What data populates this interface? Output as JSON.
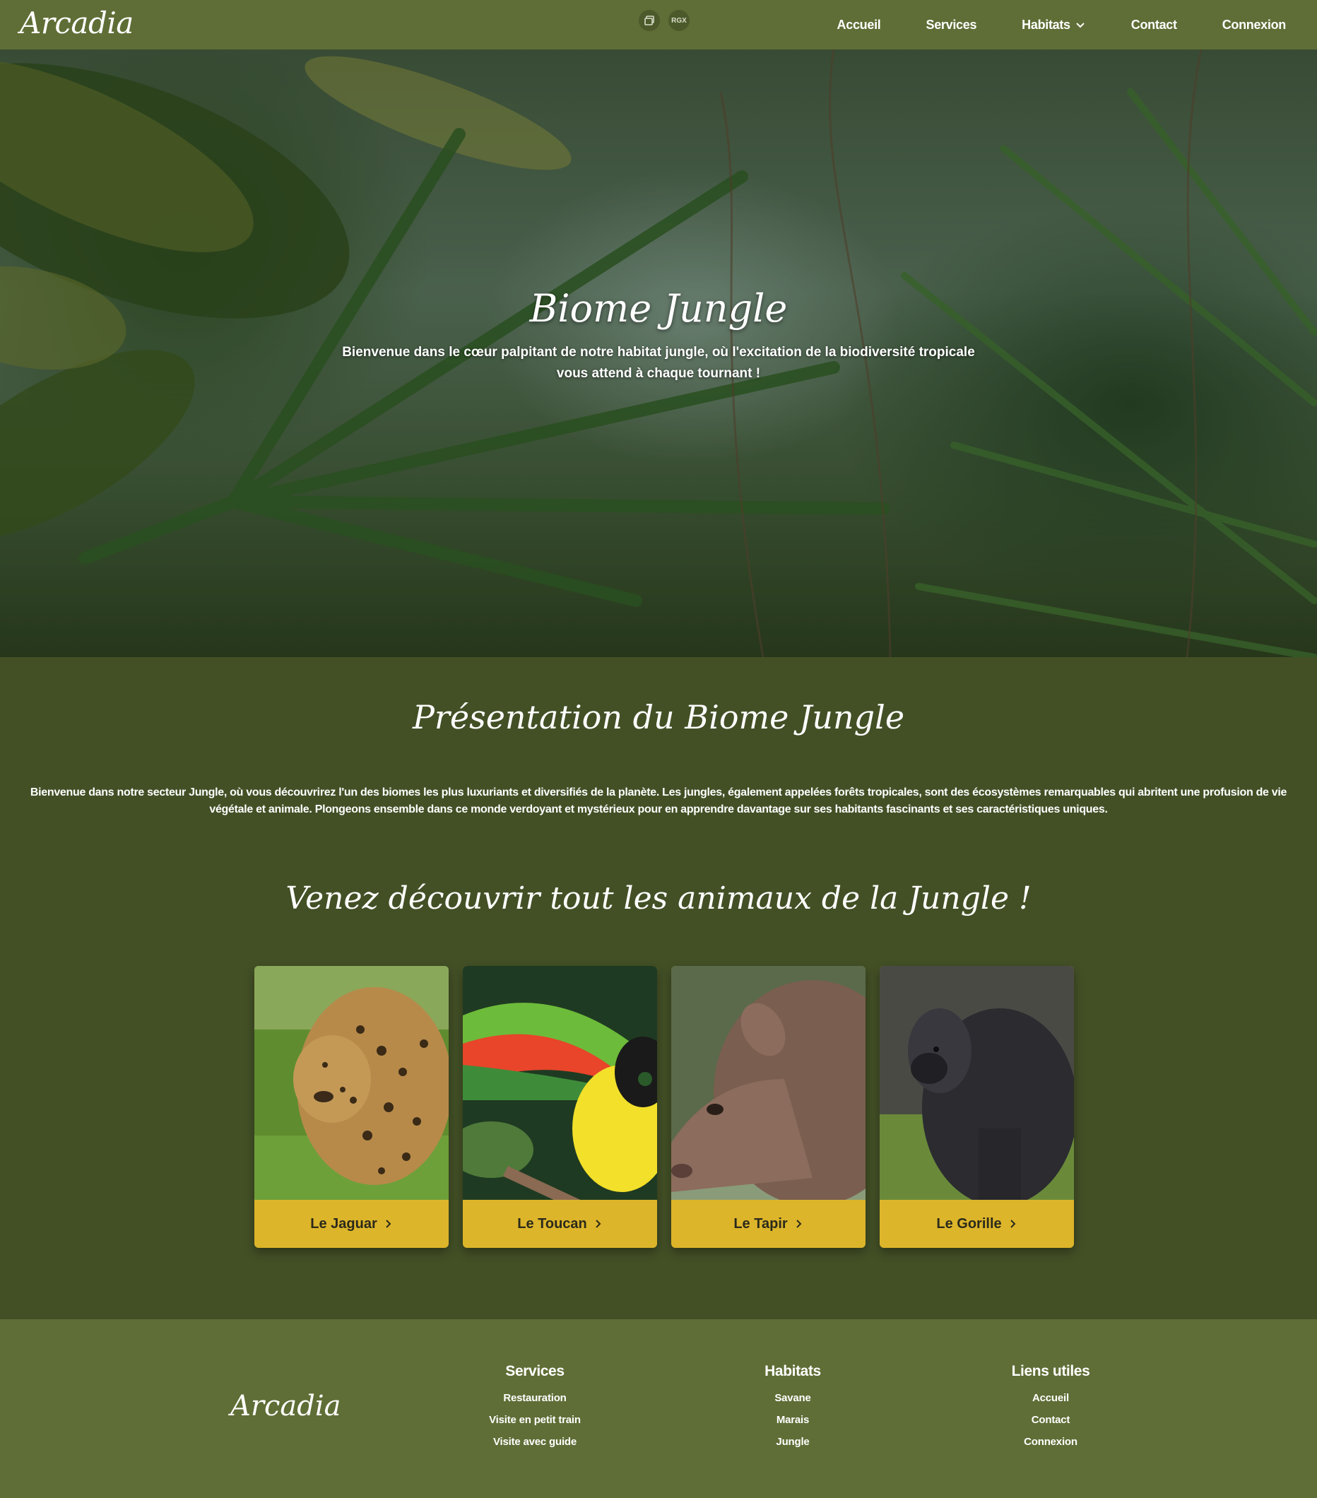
{
  "header": {
    "brand": "Arcadia",
    "tools": [
      "image-icon",
      "RGX"
    ],
    "nav": [
      {
        "label": "Accueil"
      },
      {
        "label": "Services"
      },
      {
        "label": "Habitats",
        "has_dropdown": true
      },
      {
        "label": "Contact"
      },
      {
        "label": "Connexion"
      }
    ]
  },
  "hero": {
    "title": "Biome Jungle",
    "subtitle": "Bienvenue dans le cœur palpitant de notre habitat jungle, où l'excitation de la biodiversité tropicale vous attend à chaque tournant !"
  },
  "presentation": {
    "title": "Présentation du Biome Jungle",
    "text": "Bienvenue dans notre secteur Jungle, où vous découvrirez l'un des biomes les plus luxuriants et diversifiés de la planète. Les jungles, également appelées forêts tropicales, sont des écosystèmes remarquables qui abritent une profusion de vie végétale et animale. Plongeons ensemble dans ce monde verdoyant et mystérieux pour en apprendre davantage sur ses habitants fascinants et ses caractéristiques uniques."
  },
  "animals": {
    "title": "Venez découvrir tout les animaux de la Jungle !",
    "cards": [
      {
        "label": "Le Jaguar",
        "photo": "jaguar"
      },
      {
        "label": "Le Toucan",
        "photo": "toucan"
      },
      {
        "label": "Le Tapir",
        "photo": "tapir"
      },
      {
        "label": "Le Gorille",
        "photo": "gorilla"
      }
    ]
  },
  "footer": {
    "brand": "Arcadia",
    "columns": [
      {
        "title": "Services",
        "links": [
          "Restauration",
          "Visite en petit train",
          "Visite avec guide"
        ]
      },
      {
        "title": "Habitats",
        "links": [
          "Savane",
          "Marais",
          "Jungle"
        ]
      },
      {
        "title": "Liens utiles",
        "links": [
          "Accueil",
          "Contact",
          "Connexion"
        ]
      }
    ]
  },
  "colors": {
    "navbar": "#5f6e36",
    "page_background": "#435026",
    "card_button": "#ddb52a",
    "text": "#ffffff"
  }
}
